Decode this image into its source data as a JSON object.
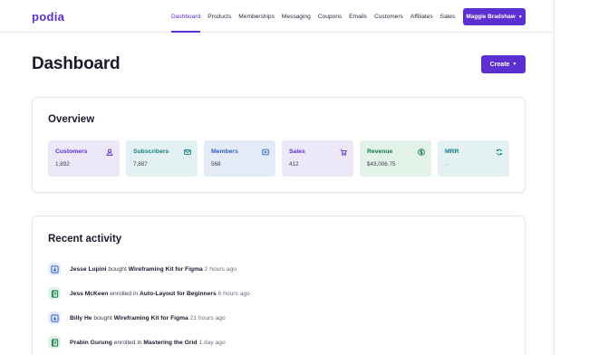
{
  "brand": {
    "logo": "podia",
    "accent": "#5b2fd1"
  },
  "nav": {
    "links": [
      {
        "label": "Dashboard",
        "active": true
      },
      {
        "label": "Products"
      },
      {
        "label": "Memberships"
      },
      {
        "label": "Messaging"
      },
      {
        "label": "Coupons"
      },
      {
        "label": "Emails"
      },
      {
        "label": "Customers"
      },
      {
        "label": "Affiliates"
      },
      {
        "label": "Sales"
      }
    ],
    "user_name": "Maggie Bradshaw"
  },
  "page": {
    "title": "Dashboard",
    "create_label": "Create"
  },
  "overview": {
    "title": "Overview",
    "stats": [
      {
        "label": "Customers",
        "value": "1,892",
        "icon": "user-icon",
        "color": "#5b2fd1",
        "bg": "#ece8f8"
      },
      {
        "label": "Subscribers",
        "value": "7,887",
        "icon": "mail-icon",
        "color": "#0f7f86",
        "bg": "#e4f1f2"
      },
      {
        "label": "Members",
        "value": "568",
        "icon": "plus-box-icon",
        "color": "#2d5fc9",
        "bg": "#e4ebf7"
      },
      {
        "label": "Sales",
        "value": "412",
        "icon": "cart-icon",
        "color": "#5b2fd1",
        "bg": "#ece8f8"
      },
      {
        "label": "Revenue",
        "value": "$43,006.75",
        "icon": "dollar-icon",
        "color": "#0c7a43",
        "bg": "#e3f2e8"
      },
      {
        "label": "MRR",
        "value": "--",
        "icon": "refresh-icon",
        "color": "#0f7f86",
        "bg": "#e4f1f2"
      }
    ]
  },
  "activity": {
    "title": "Recent activity",
    "items": [
      {
        "name": "Jesse Lupini",
        "verb": "bought",
        "item": "Wireframing Kit for Figma",
        "time": "2 hours ago",
        "icon": "download-icon"
      },
      {
        "name": "Jess McKeen",
        "verb": "enrolled in",
        "item": "Auto-Layout for Beginners",
        "time": "6 hours ago",
        "icon": "course-icon"
      },
      {
        "name": "Billy He",
        "verb": "bought",
        "item": "Wireframing Kit for Figma",
        "time": "21 hours ago",
        "icon": "download-icon"
      },
      {
        "name": "Prabin Gurung",
        "verb": "enrolled in",
        "item": "Mastering the Grid",
        "time": "1 day ago",
        "icon": "course-icon"
      }
    ]
  }
}
